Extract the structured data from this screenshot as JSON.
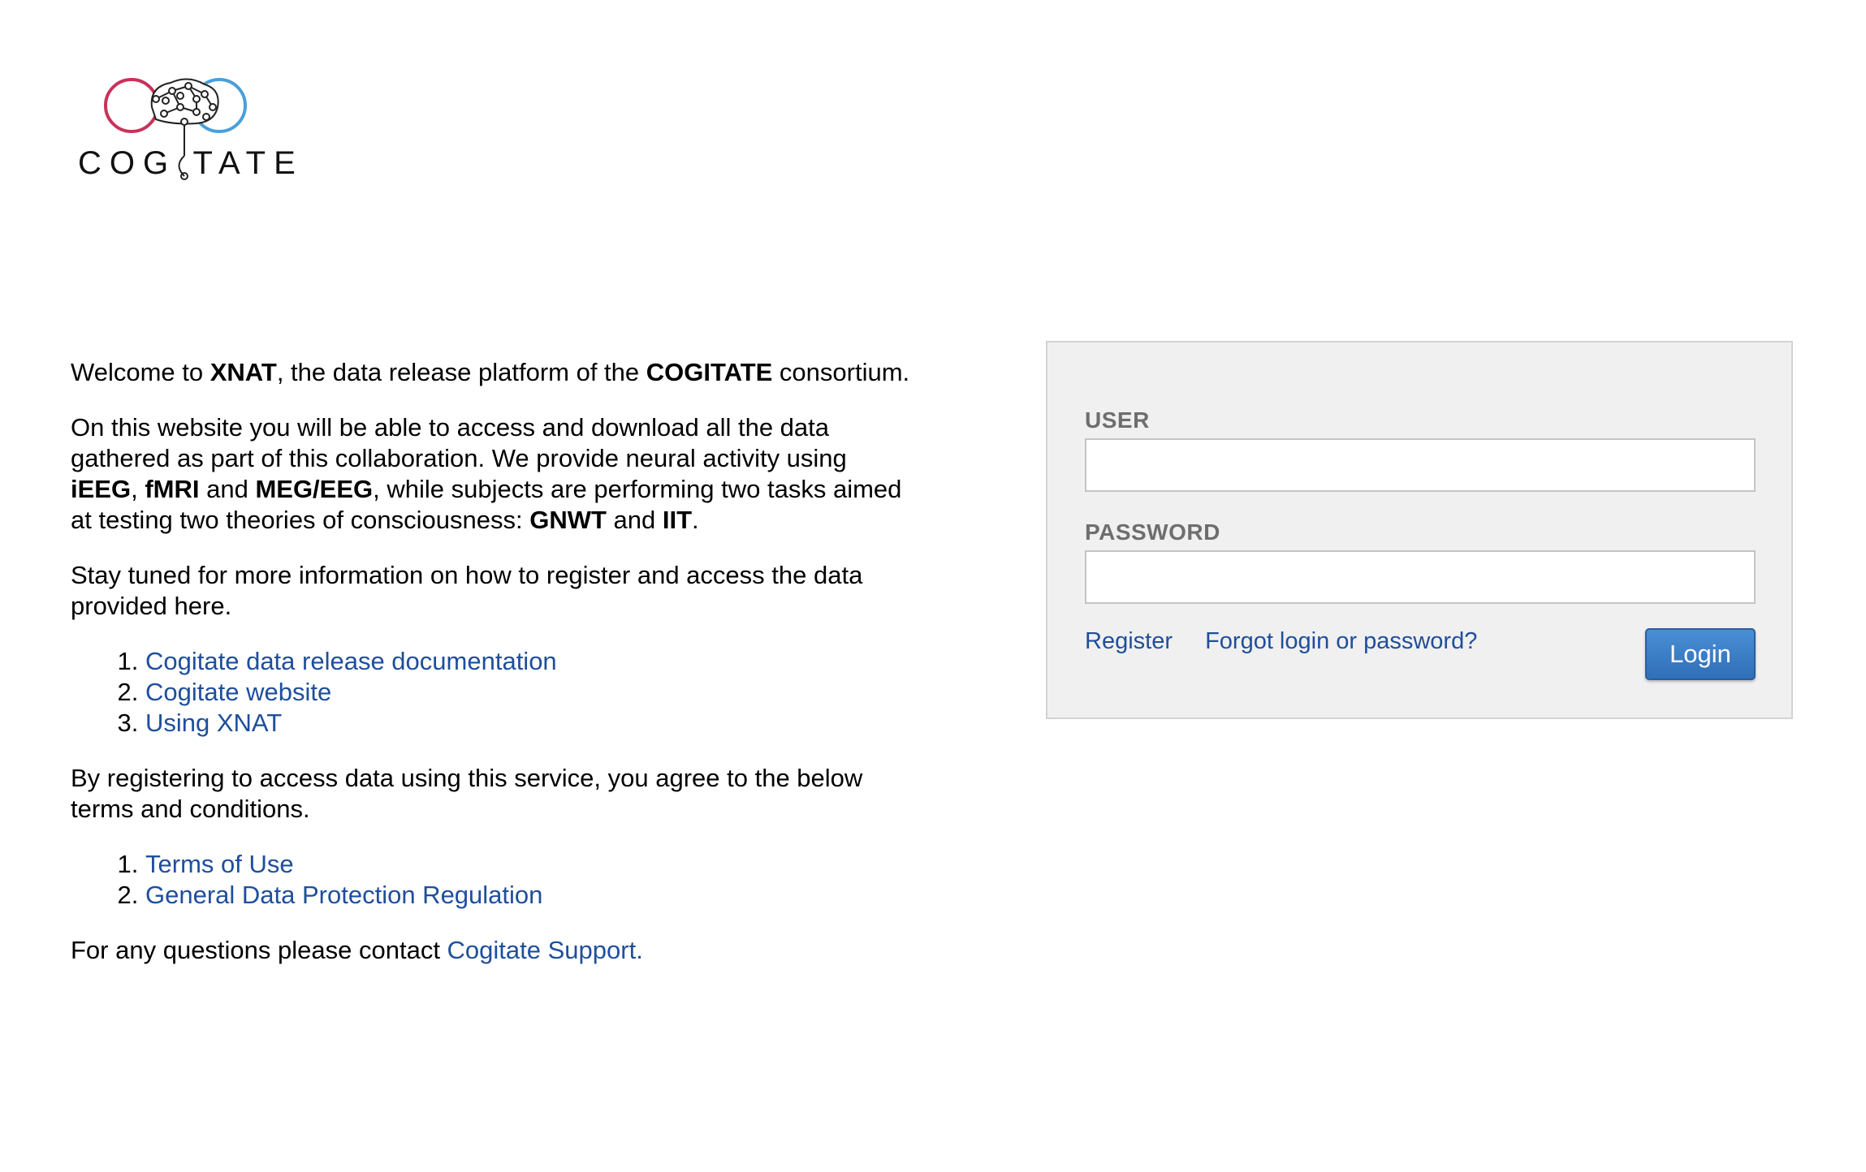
{
  "logo": {
    "text": "COG TATE",
    "colors": {
      "left_ring": "#c8325a",
      "right_ring": "#4a9fd8",
      "brain": "#222222"
    }
  },
  "intro": {
    "p1": {
      "t1": "Welcome to ",
      "b1": "XNAT",
      "t2": ", the data release platform of the ",
      "b2": "COGITATE",
      "t3": " consortium."
    },
    "p2": {
      "t1": "On this website you will be able to access and download all the data gathered as part of this collaboration. We provide neural activity using ",
      "b1": "iEEG",
      "t2": ", ",
      "b2": "fMRI",
      "t3": " and ",
      "b3": "MEG/EEG",
      "t4": ", while subjects are performing two tasks aimed at testing two theories of consciousness: ",
      "b4": "GNWT",
      "t5": " and ",
      "b5": "IIT",
      "t6": "."
    },
    "p3": "Stay tuned for more information on how to register and access the data provided here.",
    "resources": [
      {
        "label": "Cogitate data release documentation"
      },
      {
        "label": "Cogitate website"
      },
      {
        "label": "Using XNAT"
      }
    ],
    "p4": "By registering to access data using this service, you agree to the below terms and conditions.",
    "terms": [
      {
        "label": "Terms of Use"
      },
      {
        "label": "General Data Protection Regulation"
      }
    ],
    "contact": {
      "text": "For any questions please contact ",
      "link": "Cogitate Support."
    }
  },
  "login": {
    "user_label": "USER",
    "user_value": "",
    "password_label": "PASSWORD",
    "password_value": "",
    "register_link": "Register",
    "forgot_link": "Forgot login or password?",
    "login_button": "Login",
    "colors": {
      "panel_bg": "#f0f0f0",
      "button": "#3a7cc4",
      "link": "#1f4e9c"
    }
  }
}
